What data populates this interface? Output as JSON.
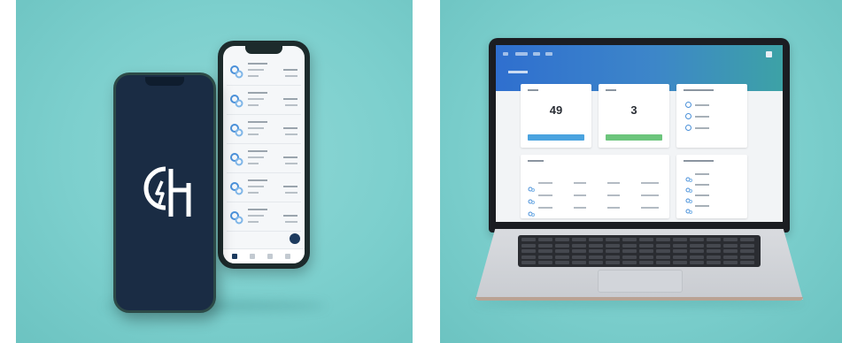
{
  "left_scene": {
    "back_phone": {
      "list_rows": 6
    },
    "front_phone": {
      "logo": "brand-logo"
    }
  },
  "right_scene": {
    "dashboard": {
      "stat_cards": [
        {
          "value": "49",
          "bar_color": "#4aa3df"
        },
        {
          "value": "3",
          "bar_color": "#6cc57c"
        }
      ]
    }
  },
  "colors": {
    "background": "#7ccfcd",
    "phone_front": "#1a2c44",
    "header": "#2f6fcf"
  }
}
